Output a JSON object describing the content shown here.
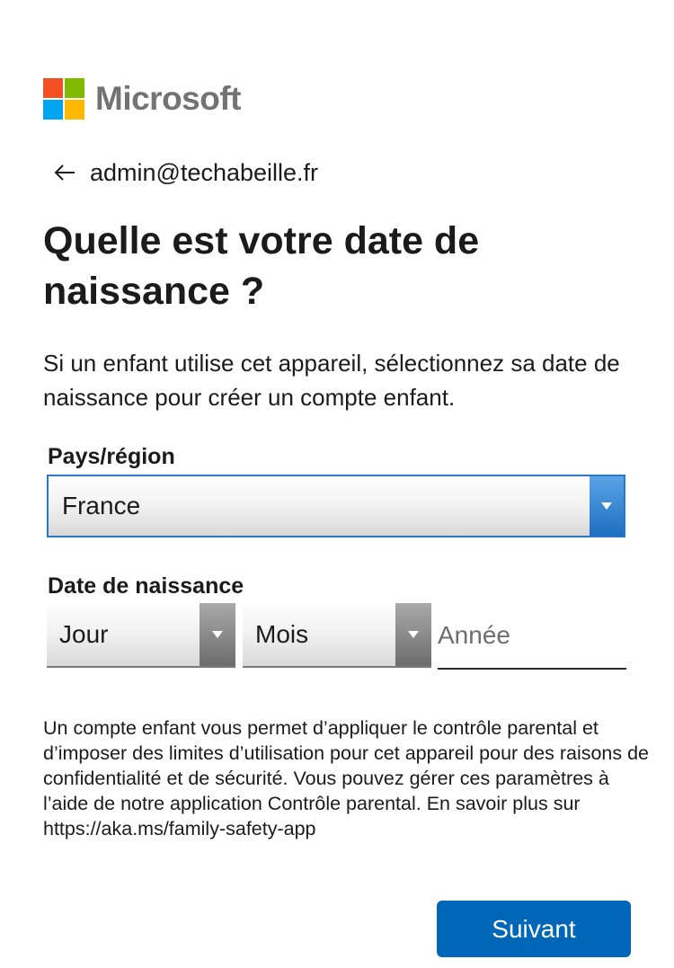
{
  "brand": {
    "name": "Microsoft",
    "colors": [
      "#f25022",
      "#7fba00",
      "#00a4ef",
      "#ffb900"
    ],
    "text_color": "#737373"
  },
  "identity": {
    "back_icon": "arrow-left-icon",
    "email": "admin@techabeille.fr"
  },
  "page": {
    "title": "Quelle est votre date de naissance ?",
    "description": "Si un enfant utilise cet appareil, sélectionnez sa date de naissance pour créer un compte enfant."
  },
  "country": {
    "label": "Pays/région",
    "selected": "France",
    "dropdown_icon": "triangle-down-icon",
    "accent": "#2b78c6"
  },
  "birthdate": {
    "label": "Date de naissance",
    "day_selected": "Jour",
    "month_selected": "Mois",
    "year_placeholder": "Année",
    "year_value": ""
  },
  "info_text": "Un compte enfant vous permet d’appliquer le contrôle parental et d’imposer des limites d’utilisation pour cet appareil pour des raisons de confidentialité et de sécurité. Vous pouvez gérer ces paramètres à l’aide de notre application Contrôle parental. En savoir plus sur https://aka.ms/family-safety-app",
  "actions": {
    "next_label": "Suivant",
    "next_color": "#0067b8"
  }
}
